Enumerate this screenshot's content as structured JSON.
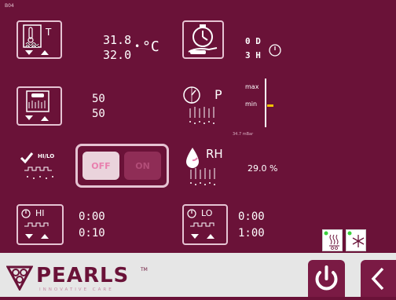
{
  "screen_id": "B04",
  "temperature": {
    "letter": "T",
    "measured": "31.8",
    "setpoint": "32.0",
    "unit": "°C",
    "degree_dot": "•"
  },
  "timer": {
    "days": "0 D",
    "hours": "3 H"
  },
  "humidity_level": {
    "measured": "50",
    "setpoint": "50"
  },
  "pressure": {
    "letter": "P",
    "scale_max": "max",
    "scale_min": "min",
    "reading": "34.7 mBar"
  },
  "hilo": {
    "label": "HI/LO",
    "off_label": "OFF",
    "on_label": "ON"
  },
  "rh": {
    "label": "RH",
    "value": "29.0 %"
  },
  "hi": {
    "label": "HI",
    "time1": "0:00",
    "time2": "0:10"
  },
  "lo": {
    "label": "LO",
    "time1": "0:00",
    "time2": "1:00"
  },
  "brand": {
    "name": "PEARLS",
    "tm": "TM",
    "tagline": "INNOVATIVE CARE"
  },
  "colors": {
    "background": "#6a1238",
    "border": "#e6c3d3",
    "accent": "#f2c200",
    "status_green": "#3bd13b"
  }
}
